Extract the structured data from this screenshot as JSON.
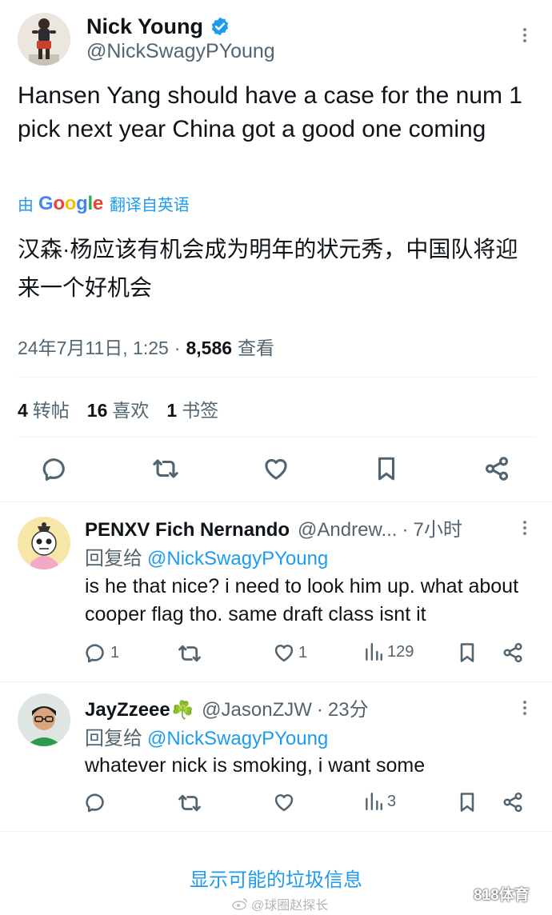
{
  "main_tweet": {
    "author_name": "Nick Young",
    "author_handle": "@NickSwagyPYoung",
    "verified": true,
    "text": "Hansen Yang should have a case for the num 1 pick next year China got a good one coming",
    "translation_prefix": "由",
    "translation_provider": "Google",
    "translation_suffix": "翻译自英语",
    "translated_text": "汉森·杨应该有机会成为明年的状元秀，中国队将迎来一个好机会",
    "date": "24年7月11日, 1:25",
    "meta_separator": "·",
    "views_count": "8,586",
    "views_label": "查看",
    "stats": {
      "retweets_count": "4",
      "retweets_label": "转帖",
      "likes_count": "16",
      "likes_label": "喜欢",
      "bookmarks_count": "1",
      "bookmarks_label": "书签"
    }
  },
  "replies": [
    {
      "author_name": "PENXV Fich Nernando",
      "author_handle": "@Andrew...",
      "time": "7小时",
      "reply_to_label": "回复给",
      "reply_to_handle": "@NickSwagyPYoung",
      "text": "is he that nice? i need to look him up. what about cooper flag tho. same draft class isnt it",
      "reply_count": "1",
      "like_count": "1",
      "view_count": "129"
    },
    {
      "author_name": "JayZzeee",
      "author_emoji": "☘️",
      "author_handle": "@JasonZJW",
      "time": "23分",
      "reply_to_label": "回复给",
      "reply_to_handle": "@NickSwagyPYoung",
      "text": "whatever nick is smoking, i want some",
      "view_count": "3"
    }
  ],
  "spam_link": "显示可能的垃圾信息",
  "watermark": {
    "left": "@球圈赵探长",
    "right": "818体育"
  },
  "colors": {
    "link_blue": "#1d9bf0",
    "secondary_text": "#536471",
    "divider": "#eff3f4",
    "verified_blue": "#1d9bf0"
  }
}
